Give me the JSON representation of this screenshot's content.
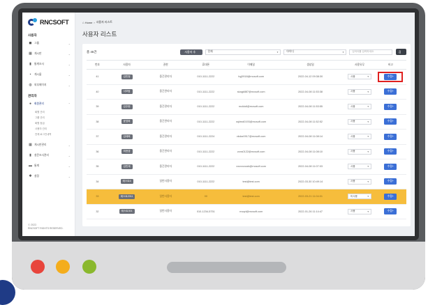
{
  "logo": {
    "text": "RNCSOFT"
  },
  "sidebar": {
    "sections": [
      {
        "title": "사용자",
        "items": [
          {
            "icon": "group-icon",
            "glyph": "◼",
            "label": "그룹"
          },
          {
            "icon": "grid-icon",
            "glyph": "▦",
            "label": "게시판"
          },
          {
            "icon": "chart-icon",
            "glyph": "▮",
            "label": "통계조사"
          },
          {
            "icon": "lock-icon",
            "glyph": "▪",
            "label": "게시물"
          },
          {
            "icon": "globe-icon",
            "glyph": "◍",
            "label": "외부페이지"
          }
        ]
      },
      {
        "title": "관리자",
        "items": [
          {
            "icon": "user-icon",
            "glyph": "●",
            "label": "회원관리",
            "active": true
          }
        ]
      }
    ],
    "subitems": [
      "회원 관리",
      "그룹 관리",
      "회원 등급",
      "사용자 관리",
      "전체 로그인내역"
    ],
    "bottom_items": [
      {
        "icon": "grid-icon",
        "glyph": "▦",
        "label": "게시판관리"
      },
      {
        "icon": "chart-icon",
        "glyph": "▮",
        "label": "설문조사관리"
      },
      {
        "icon": "bar-chart-icon",
        "glyph": "▬",
        "label": "통계"
      },
      {
        "icon": "gear-icon",
        "glyph": "✱",
        "label": "설정"
      }
    ],
    "copyright_line1": "ⓒ 2022.",
    "copyright_line2": "RNCSOFT RIGHTS RESERVED."
  },
  "breadcrumb": {
    "home": "Home",
    "sep": "›",
    "current": "사용자 리스트"
  },
  "page_title": "사용자 리스트",
  "toolbar": {
    "count": "총 45건",
    "add_button": "사용자 추가",
    "filter1": "전체",
    "filter2": "아이디",
    "search_placeholder": "검색어를 입력하세요",
    "search_button": "검색"
  },
  "table": {
    "headers": [
      "번호",
      "사용자",
      "권한",
      "휴대폰",
      "이메일",
      "생성일",
      "사용유무",
      "비고"
    ],
    "rows": [
      {
        "no": "41",
        "name": "김민정",
        "role": "중간관리자",
        "phone": "010-1111-2222",
        "email": "hyj0918@rncsoft.com",
        "date": "2022-04-12 09:38:30",
        "status": "사용",
        "edit": "수정+",
        "marked": true
      },
      {
        "no": "40",
        "name": "서보람",
        "role": "중간관리자",
        "phone": "010-1111-2222",
        "email": "skagk887@rncsoft.com",
        "date": "2022-04-08 11:53:38",
        "status": "사용",
        "edit": "수정+"
      },
      {
        "no": "39",
        "name": "김주현",
        "role": "중간관리자",
        "phone": "010-1111-2222",
        "email": "rnckkdl@rncsoft.com",
        "date": "2022-04-08 11:53:55",
        "status": "사용",
        "edit": "수정+"
      },
      {
        "no": "38",
        "name": "윤영희",
        "role": "중간관리자",
        "phone": "010-1111-2222",
        "email": "wjdrnd0193@rncsoft.com",
        "date": "2022-04-08 11:52:52",
        "status": "사용",
        "edit": "수정+"
      },
      {
        "no": "37",
        "name": "김태희",
        "role": "중간관리자",
        "phone": "010-1111-2224",
        "email": "vkdzz0917@rncsoft.com",
        "date": "2022-04-08 11:08:14",
        "status": "사용",
        "edit": "수정+"
      },
      {
        "no": "36",
        "name": "최현경",
        "role": "중간관리자",
        "phone": "010-1111-2222",
        "email": "zzxs0122@rncsoft.com",
        "date": "2022-04-08 11:08:10",
        "status": "사용",
        "edit": "수정+"
      },
      {
        "no": "35",
        "name": "김민재",
        "role": "중간관리자",
        "phone": "010-1111-2222",
        "email": "xxcvxcxzzk@rncsoft.com",
        "date": "2022-04-08 11:07:03",
        "status": "사용",
        "edit": "수정+"
      },
      {
        "no": "34",
        "name": "테스트6",
        "role": "일반사용자",
        "phone": "010-1111-2222",
        "email": "test@test.com",
        "date": "2022-03-30 10:49:14",
        "status": "사용",
        "edit": "수정+"
      },
      {
        "no": "33",
        "name": "테스트2011",
        "role": "일반사용자",
        "phone": "00",
        "email": "test@test.com",
        "date": "2022-03-21 11:04:01",
        "status": "미사용",
        "edit": "수정+",
        "highlight": true
      },
      {
        "no": "32",
        "name": "테스트301",
        "role": "일반사용자",
        "phone": "010-1234-5751",
        "email": "rncqrt@rncsoft.com",
        "date": "2022-01-26 11:14:47",
        "status": "사용",
        "edit": "수정+"
      }
    ]
  },
  "colors": {
    "edit_button": "#3b6fd6",
    "highlight_row": "#f6bd3c",
    "marker": "#e0201f",
    "window_red": "#e8453c",
    "window_yellow": "#f4ad1c",
    "window_green": "#8ab82d"
  }
}
